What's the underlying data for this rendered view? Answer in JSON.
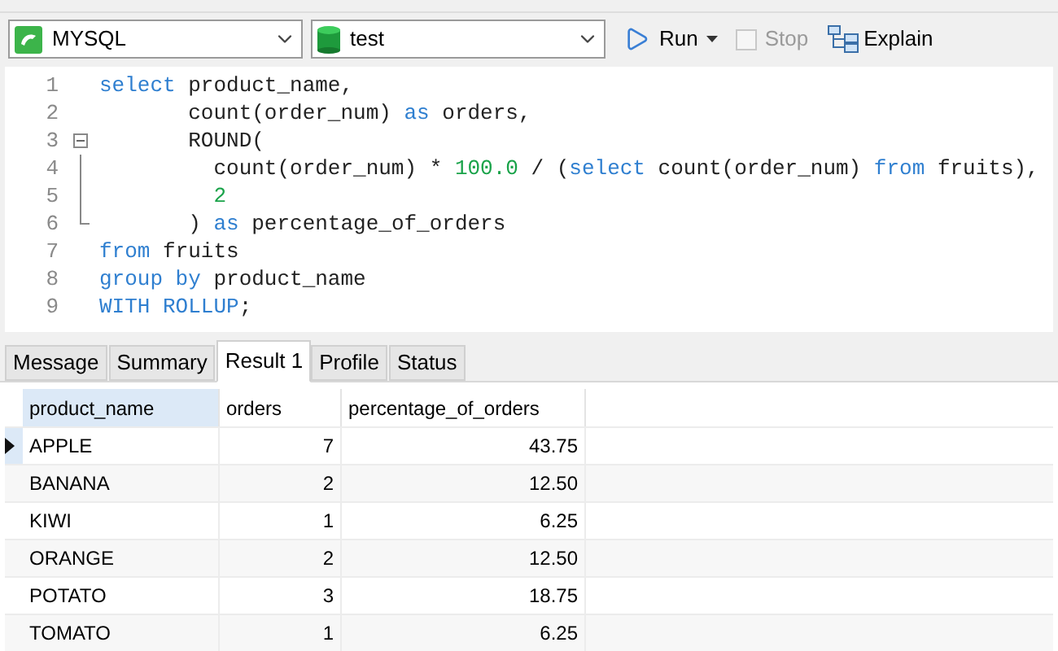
{
  "toolbar": {
    "connection": "MYSQL",
    "database": "test",
    "run": "Run",
    "stop": {
      "label": "Stop",
      "disabled": true
    },
    "explain": "Explain"
  },
  "editor": {
    "lines": [
      {
        "number": "1",
        "tokens": [
          {
            "kind": "keyword",
            "text": "select"
          },
          {
            "kind": "plain",
            "text": " product_name,"
          }
        ]
      },
      {
        "number": "2",
        "tokens": [
          {
            "kind": "plain",
            "text": "       count(order_num) "
          },
          {
            "kind": "keyword",
            "text": "as"
          },
          {
            "kind": "plain",
            "text": " orders,"
          }
        ]
      },
      {
        "number": "3",
        "kind": "fold_start",
        "tokens": [
          {
            "kind": "plain",
            "text": "       ROUND("
          }
        ]
      },
      {
        "number": "4",
        "kind": "fold_body",
        "tokens": [
          {
            "kind": "plain",
            "text": "         count(order_num) * "
          },
          {
            "kind": "number",
            "text": "100.0"
          },
          {
            "kind": "plain",
            "text": " / ("
          },
          {
            "kind": "keyword",
            "text": "select"
          },
          {
            "kind": "plain",
            "text": " count(order_num) "
          },
          {
            "kind": "keyword",
            "text": "from"
          },
          {
            "kind": "plain",
            "text": " fruits),"
          }
        ]
      },
      {
        "number": "5",
        "kind": "fold_body",
        "tokens": [
          {
            "kind": "number",
            "text": "         2"
          }
        ]
      },
      {
        "number": "6",
        "kind": "fold_end",
        "tokens": [
          {
            "kind": "plain",
            "text": "       ) "
          },
          {
            "kind": "keyword",
            "text": "as"
          },
          {
            "kind": "plain",
            "text": " percentage_of_orders"
          }
        ]
      },
      {
        "number": "7",
        "tokens": [
          {
            "kind": "keyword",
            "text": "from"
          },
          {
            "kind": "plain",
            "text": " fruits"
          }
        ]
      },
      {
        "number": "8",
        "tokens": [
          {
            "kind": "keyword",
            "text": "group by"
          },
          {
            "kind": "plain",
            "text": " product_name"
          }
        ]
      },
      {
        "number": "9",
        "tokens": [
          {
            "kind": "keyword",
            "text": "WITH ROLLUP"
          },
          {
            "kind": "plain",
            "text": ";"
          }
        ]
      }
    ]
  },
  "result_tabs": [
    {
      "label": "Message",
      "selected": false
    },
    {
      "label": "Summary",
      "selected": false
    },
    {
      "label": "Result 1",
      "selected": true
    },
    {
      "label": "Profile",
      "selected": false
    },
    {
      "label": "Status",
      "selected": false
    }
  ],
  "table": {
    "columns": [
      "product_name",
      "orders",
      "percentage_of_orders"
    ],
    "rows": [
      {
        "selected": true,
        "cells": [
          "APPLE",
          "7",
          "43.75"
        ]
      },
      {
        "selected": false,
        "cells": [
          "BANANA",
          "2",
          "12.50"
        ]
      },
      {
        "selected": false,
        "cells": [
          "KIWI",
          "1",
          "6.25"
        ]
      },
      {
        "selected": false,
        "cells": [
          "ORANGE",
          "2",
          "12.50"
        ]
      },
      {
        "selected": false,
        "cells": [
          "POTATO",
          "3",
          "18.75"
        ]
      },
      {
        "selected": false,
        "cells": [
          "TOMATO",
          "1",
          "6.25"
        ]
      }
    ]
  }
}
